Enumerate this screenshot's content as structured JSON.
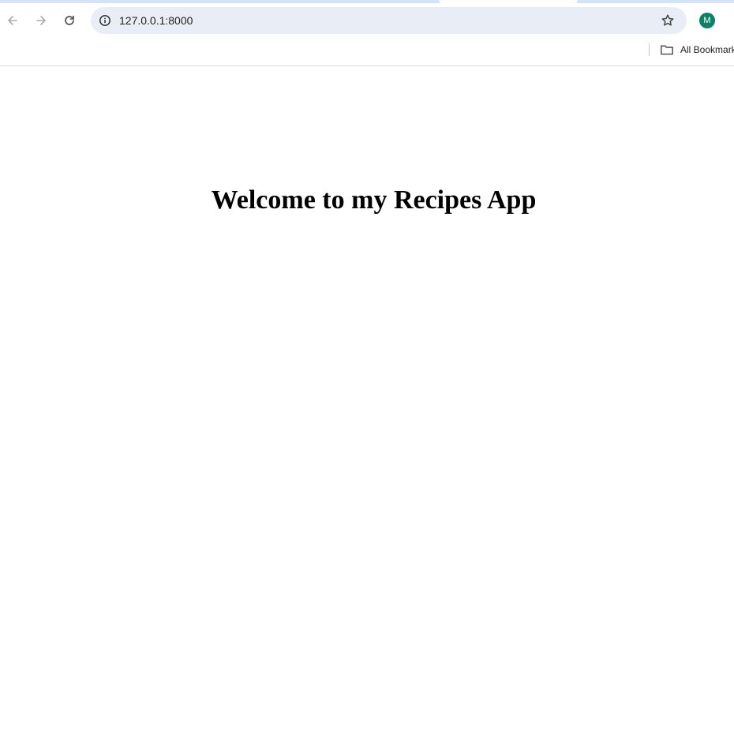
{
  "browser": {
    "address_bar": {
      "url": "127.0.0.1:8000"
    },
    "profile": {
      "initial": "M",
      "color": "#0b8266"
    },
    "bookmarks_bar": {
      "all_bookmarks_label": "All Bookmarks"
    },
    "icons": {
      "back": "back-arrow-icon",
      "forward": "forward-arrow-icon",
      "reload": "reload-icon",
      "site_info": "info-icon",
      "bookmark_star": "star-icon",
      "folder": "folder-icon"
    }
  },
  "page": {
    "heading": "Welcome to my Recipes App"
  }
}
